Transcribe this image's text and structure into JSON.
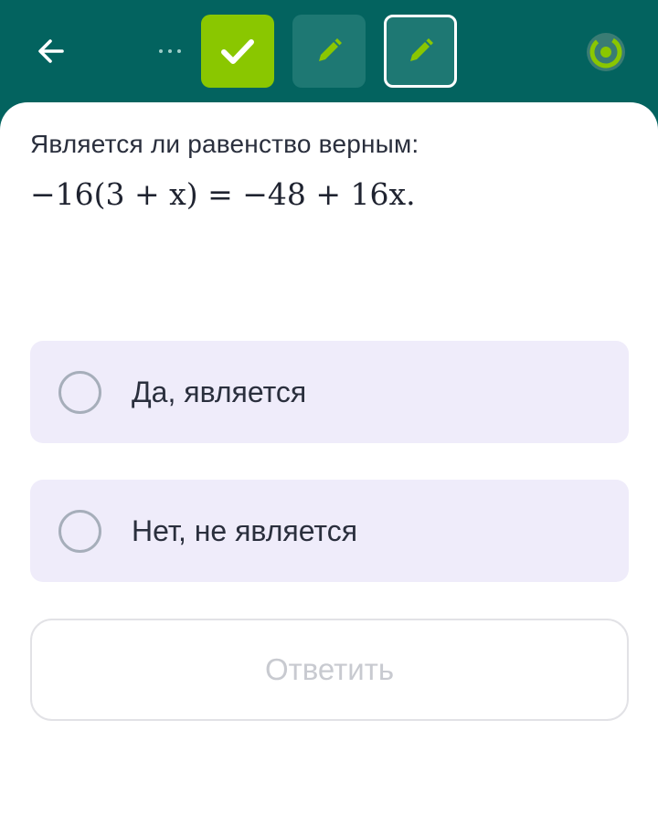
{
  "header": {
    "back_icon": "arrow-left-icon",
    "more_icon": "more-dots-icon",
    "steps": [
      {
        "state": "done",
        "icon": "checkmark-icon"
      },
      {
        "state": "pending",
        "icon": "pencil-icon"
      },
      {
        "state": "current",
        "icon": "pencil-icon"
      }
    ],
    "progress_icon": "target-progress-icon"
  },
  "question": {
    "text": "Является ли равенство верным:",
    "formula": "−16(3 + x) = −48 + 16x."
  },
  "options": [
    {
      "label": "Да, является",
      "selected": false
    },
    {
      "label": "Нет, не является",
      "selected": false
    }
  ],
  "submit": {
    "label": "Ответить",
    "enabled": false
  },
  "colors": {
    "header_bg": "#03635f",
    "accent_green": "#8ac700",
    "option_bg": "#efecfa",
    "text": "#2a2f3d",
    "disabled_text": "#c8cad0"
  }
}
